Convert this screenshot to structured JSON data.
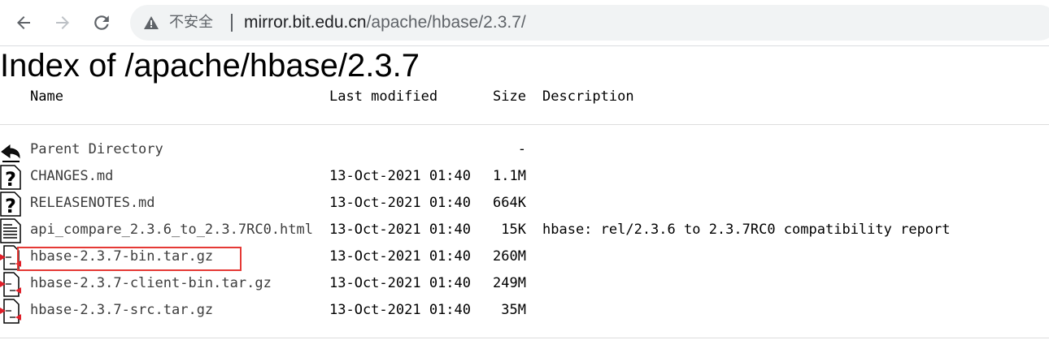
{
  "browser": {
    "security_label": "不安全",
    "url_host": "mirror.bit.edu.cn",
    "url_path": "/apache/hbase/2.3.7/"
  },
  "page": {
    "title": "Index of /apache/hbase/2.3.7"
  },
  "table": {
    "headers": {
      "name": "Name",
      "last_modified": "Last modified",
      "size": "Size",
      "description": "Description"
    },
    "rows": [
      {
        "icon": "back-arrow-icon",
        "name": "Parent Directory",
        "last_modified": "",
        "size": "-",
        "description": ""
      },
      {
        "icon": "unknown-file-icon",
        "name": "CHANGES.md",
        "last_modified": "13-Oct-2021 01:40",
        "size": "1.1M",
        "description": ""
      },
      {
        "icon": "unknown-file-icon",
        "name": "RELEASENOTES.md",
        "last_modified": "13-Oct-2021 01:40",
        "size": "664K",
        "description": ""
      },
      {
        "icon": "text-file-icon",
        "name": "api_compare_2.3.6_to_2.3.7RC0.html",
        "last_modified": "13-Oct-2021 01:40",
        "size": "15K",
        "description": "hbase: rel/2.3.6 to 2.3.7RC0 compatibility report"
      },
      {
        "icon": "compressed-file-icon",
        "name": "hbase-2.3.7-bin.tar.gz",
        "last_modified": "13-Oct-2021 01:40",
        "size": "260M",
        "description": ""
      },
      {
        "icon": "compressed-file-icon",
        "name": "hbase-2.3.7-client-bin.tar.gz",
        "last_modified": "13-Oct-2021 01:40",
        "size": "249M",
        "description": ""
      },
      {
        "icon": "compressed-file-icon",
        "name": "hbase-2.3.7-src.tar.gz",
        "last_modified": "13-Oct-2021 01:40",
        "size": "35M",
        "description": ""
      }
    ]
  },
  "colors": {
    "highlight_box": "#e53935",
    "link_text": "#3c3c3c"
  }
}
